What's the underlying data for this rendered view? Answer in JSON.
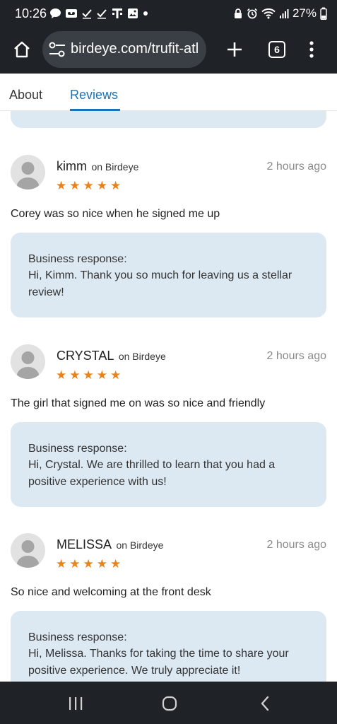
{
  "status_bar": {
    "time": "10:26",
    "battery": "27%",
    "left_icons": [
      "chat-bubble-icon",
      "voicemail-icon",
      "check-icon",
      "check-icon",
      "t-mobile-icon",
      "image-icon",
      "dot-icon"
    ],
    "right_icons": [
      "lock-icon",
      "alarm-icon",
      "wifi-icon",
      "signal-icon",
      "battery-icon"
    ]
  },
  "browser": {
    "url": "birdeye.com/trufit-atl",
    "tab_count": "6"
  },
  "tabs": [
    {
      "label": "About",
      "active": false
    },
    {
      "label": "Reviews",
      "active": true
    }
  ],
  "colors": {
    "accent": "#1a73b8",
    "star": "#e8821b",
    "response_bg": "#dde9f2",
    "chrome_bg": "#1f2328"
  },
  "reviews": [
    {
      "name": "kimm",
      "source": "on Birdeye",
      "time": "2 hours ago",
      "rating": 5,
      "text": "Corey was so nice when he signed me up",
      "response_label": "Business response:",
      "response_text": "Hi, Kimm. Thank you so much for leaving us a stellar review!"
    },
    {
      "name": "CRYSTAL",
      "source": "on Birdeye",
      "time": "2 hours ago",
      "rating": 5,
      "text": "The girl that signed me on was so nice and friendly",
      "response_label": "Business response:",
      "response_text": "Hi, Crystal. We are thrilled to learn that you had a positive experience with us!"
    },
    {
      "name": "MELISSA",
      "source": "on Birdeye",
      "time": "2 hours ago",
      "rating": 5,
      "text": "So nice and welcoming at the front desk",
      "response_label": "Business response:",
      "response_text": "Hi, Melissa. Thanks for taking the time to share your positive experience. We truly appreciate it!"
    }
  ]
}
